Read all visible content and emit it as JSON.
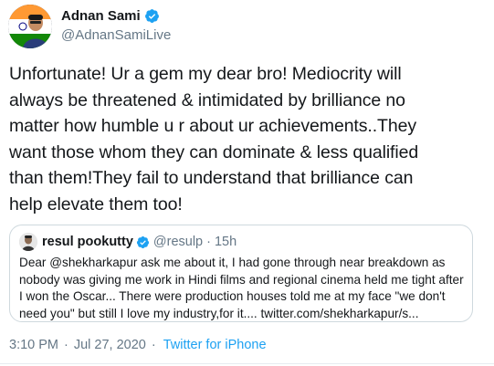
{
  "author": {
    "name": "Adnan Sami",
    "handle": "@AdnanSamiLive",
    "verified": true
  },
  "tweet": {
    "text": "Unfortunate! Ur a gem my dear bro! Mediocrity will\nalways be threatened & intimidated by brilliance no\nmatter how humble u r about ur achievements..They\nwant those whom they can dominate & less qualified\nthan them!They fail to understand that brilliance can\nhelp elevate them too!"
  },
  "quoted_tweet": {
    "name": "resul pookutty",
    "handle": "@resulp",
    "separator": "·",
    "time": "15h",
    "verified": true,
    "text": "Dear @shekharkapur ask me about it, I had gone through near breakdown as\nnobody was giving me work in Hindi films and regional cinema held me tight after\nI won the Oscar... There were production houses told me at my face \"we don't\nneed you\" but still I love my industry,for it.... twitter.com/shekharkapur/s..."
  },
  "meta": {
    "time": "3:10 PM",
    "separator": "·",
    "date": "Jul 27, 2020",
    "separator2": "·",
    "source": "Twitter for iPhone"
  },
  "colors": {
    "verified_blue": "#1da1f2",
    "link_blue": "#1da1f2",
    "secondary_text": "#657786",
    "border": "#cfd9de"
  },
  "icons": {
    "verified": "verified-badge-icon"
  }
}
